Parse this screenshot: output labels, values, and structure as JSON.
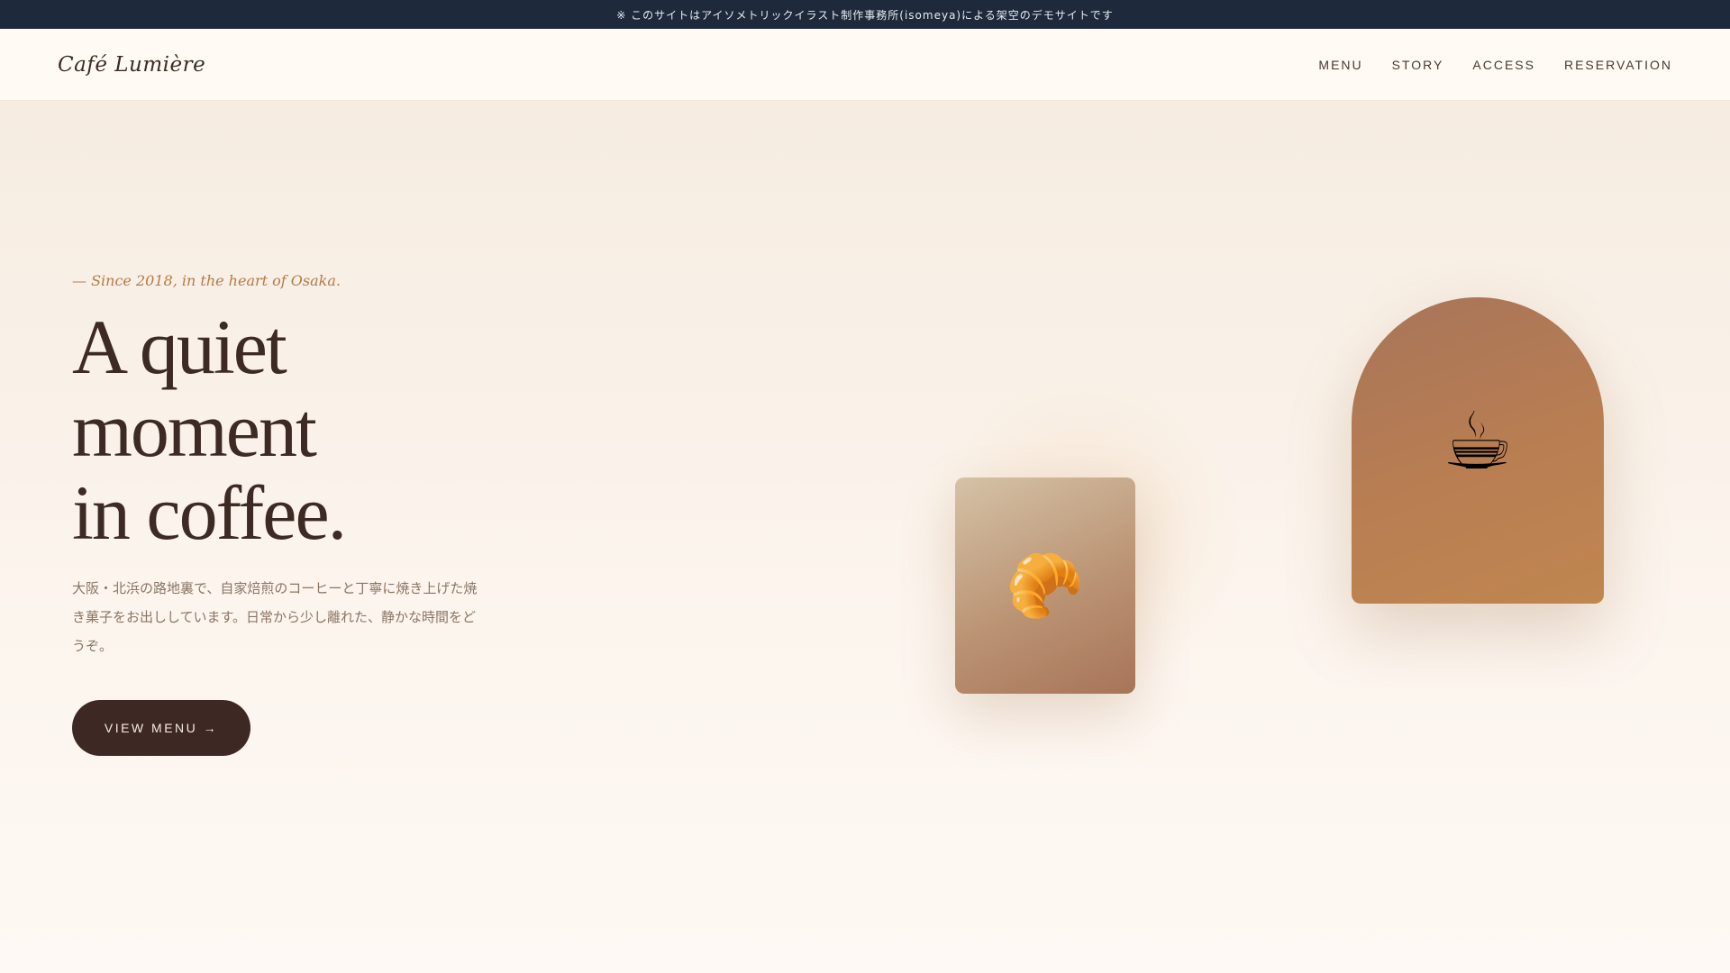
{
  "notice": {
    "text": "※ このサイトはアイソメトリックイラスト制作事務所(isomeya)による架空のデモサイトです"
  },
  "header": {
    "logo": "Café Lumière",
    "nav": [
      {
        "label": "MENU"
      },
      {
        "label": "STORY"
      },
      {
        "label": "ACCESS"
      },
      {
        "label": "RESERVATION"
      }
    ]
  },
  "hero": {
    "tagline": "— Since 2018, in the heart of Osaka.",
    "headline_lines": [
      "A quiet",
      "moment",
      "in coffee."
    ],
    "description": "大阪・北浜の路地裏で、自家焙煎のコーヒーと丁寧に焼き上げた焼き菓子をお出ししています。日常から少し離れた、静かな時間をどうぞ。",
    "cta_label": "VIEW MENU →"
  },
  "visuals": {
    "croissant_icon": "croissant-icon",
    "croissant_glyph": "🥐",
    "coffee_icon": "coffee-cup-icon",
    "coffee_glyph": "☕"
  },
  "colors": {
    "notice_bg": "#1e293b",
    "primary_dark": "#3d2824",
    "accent": "#b57b46",
    "background": "#fdf8f2"
  }
}
